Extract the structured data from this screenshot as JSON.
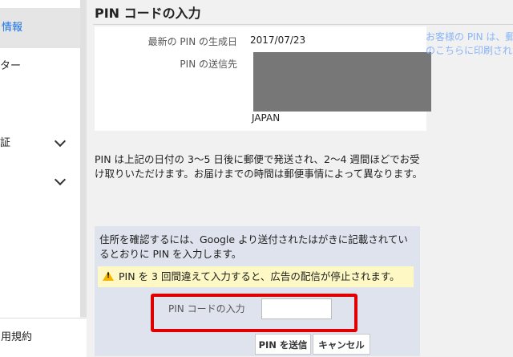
{
  "sidebar": {
    "active_item": "情報",
    "items": [
      "ター",
      "証",
      ""
    ],
    "bottom_item": "用規約"
  },
  "page": {
    "title": "PIN コードの入力"
  },
  "info": {
    "latest_pin_label": "最新の PIN の生成日",
    "latest_pin_value": "2017/07/23",
    "destination_label": "PIN の送信先",
    "country": "JAPAN"
  },
  "side_note": {
    "line1": "お客様の PIN は、郵",
    "line2": "のこちらに印刷され"
  },
  "description": "PIN は上記の日付の 3〜5 日後に郵便で発送され、2〜4 週間ほどでお受け取りいただけます。お届けまでの時間は郵便事情によって異なります。",
  "verify": {
    "instructions": "住所を確認するには、Google より送付されたはがきに記載されているとおりに PIN を入力します。",
    "warning": "PIN を 3 回間違えて入力すると、広告の配信が停止されます。",
    "pin_label": "PIN コードの入力",
    "pin_value": "",
    "submit_label": "PIN を送信",
    "cancel_label": "キャンセル"
  },
  "colors": {
    "accent": "#1a73e8",
    "highlight_border": "#e00000",
    "warning_bg": "#fdf8c4",
    "warning_icon": "#f4b400"
  }
}
